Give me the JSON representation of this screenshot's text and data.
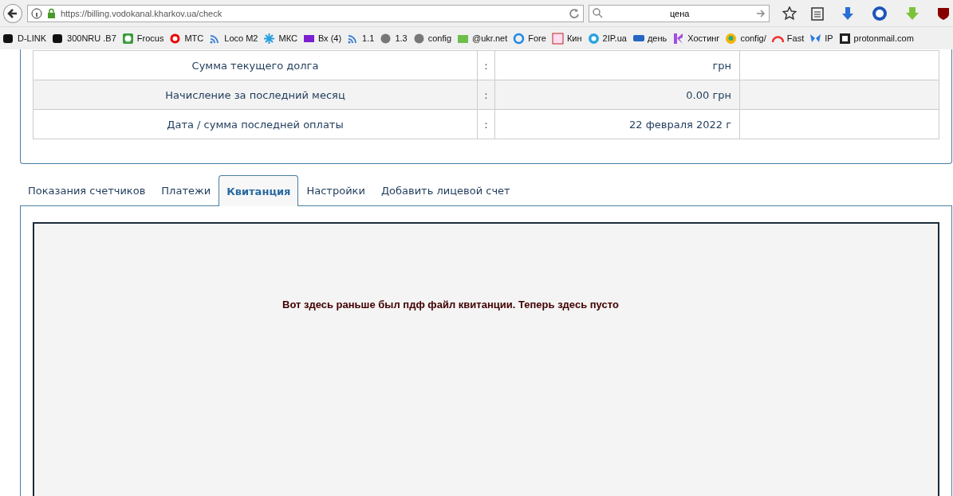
{
  "browser": {
    "url": "https://billing.vodokanal.kharkov.ua/check",
    "search_value": "цена",
    "bookmarks": [
      {
        "label": "D-LINK"
      },
      {
        "label": "300NRU .B7"
      },
      {
        "label": "Frocus"
      },
      {
        "label": "МТС"
      },
      {
        "label": "Loco M2"
      },
      {
        "label": "МКС"
      },
      {
        "label": "Вх (4)"
      },
      {
        "label": "1.1"
      },
      {
        "label": "1.3"
      },
      {
        "label": "config"
      },
      {
        "label": "@ukr.net"
      },
      {
        "label": "Fore"
      },
      {
        "label": "Кин"
      },
      {
        "label": "2IP.ua"
      },
      {
        "label": "день"
      },
      {
        "label": "Хостинг"
      },
      {
        "label": "config/"
      },
      {
        "label": "Fast"
      },
      {
        "label": "IP"
      },
      {
        "label": "protonmail.com"
      }
    ]
  },
  "account_table": {
    "rows": [
      {
        "label": "Сумма текущего долга",
        "separator": ":",
        "value": "грн"
      },
      {
        "label": "Начисление за последний месяц",
        "separator": ":",
        "value": "0.00 грн"
      },
      {
        "label": "Дата / сумма последней оплаты",
        "separator": ":",
        "value": "22 февраля 2022 г"
      }
    ]
  },
  "tabs": [
    {
      "label": "Показания счетчиков",
      "selected": false
    },
    {
      "label": "Платежи",
      "selected": false
    },
    {
      "label": "Квитанция",
      "selected": true
    },
    {
      "label": "Настройки",
      "selected": false
    },
    {
      "label": "Добавить лицевой счет",
      "selected": false
    }
  ],
  "receipt_frame": {
    "message": "Вот здесь раньше был пдф файл квитанции. Теперь здесь пусто"
  }
}
